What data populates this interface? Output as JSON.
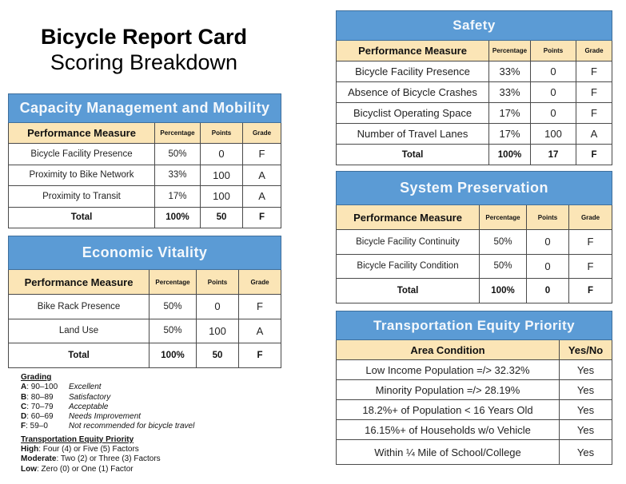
{
  "title": {
    "main": "Bicycle Report Card",
    "sub": "Scoring Breakdown"
  },
  "colors": {
    "banner": "#5b9bd5",
    "header_row": "#fbe5b6"
  },
  "columns": {
    "measure": "Performance Measure",
    "percentage": "Percentage",
    "points": "Points",
    "grade": "Grade"
  },
  "capacity": {
    "title": "Capacity Management and Mobility",
    "rows": [
      {
        "measure": "Bicycle Facility Presence",
        "percentage": "50%",
        "points": "0",
        "grade": "F"
      },
      {
        "measure": "Proximity to Bike Network",
        "percentage": "33%",
        "points": "100",
        "grade": "A"
      },
      {
        "measure": "Proximity to Transit",
        "percentage": "17%",
        "points": "100",
        "grade": "A"
      }
    ],
    "total": {
      "label": "Total",
      "percentage": "100%",
      "points": "50",
      "grade": "F"
    }
  },
  "economic": {
    "title": "Economic Vitality",
    "rows": [
      {
        "measure": "Bike Rack Presence",
        "percentage": "50%",
        "points": "0",
        "grade": "F"
      },
      {
        "measure": "Land Use",
        "percentage": "50%",
        "points": "100",
        "grade": "A"
      }
    ],
    "total": {
      "label": "Total",
      "percentage": "100%",
      "points": "50",
      "grade": "F"
    }
  },
  "safety": {
    "title": "Safety",
    "rows": [
      {
        "measure": "Bicycle Facility Presence",
        "percentage": "33%",
        "points": "0",
        "grade": "F"
      },
      {
        "measure": "Absence of Bicycle Crashes",
        "percentage": "33%",
        "points": "0",
        "grade": "F"
      },
      {
        "measure": "Bicyclist Operating Space",
        "percentage": "17%",
        "points": "0",
        "grade": "F"
      },
      {
        "measure": "Number of Travel Lanes",
        "percentage": "17%",
        "points": "100",
        "grade": "A"
      }
    ],
    "total": {
      "label": "Total",
      "percentage": "100%",
      "points": "17",
      "grade": "F"
    }
  },
  "preservation": {
    "title": "System Preservation",
    "rows": [
      {
        "measure": "Bicycle Facility Continuity",
        "percentage": "50%",
        "points": "0",
        "grade": "F"
      },
      {
        "measure": "Bicycle Facility Condition",
        "percentage": "50%",
        "points": "0",
        "grade": "F"
      }
    ],
    "total": {
      "label": "Total",
      "percentage": "100%",
      "points": "0",
      "grade": "F"
    }
  },
  "equity": {
    "title": "Transportation Equity Priority",
    "col_condition": "Area Condition",
    "col_yesno": "Yes/No",
    "rows": [
      {
        "condition": "Low Income Population =/> 32.32%",
        "value": "Yes"
      },
      {
        "condition": "Minority Population =/> 28.19%",
        "value": "Yes"
      },
      {
        "condition": "18.2%+ of Population < 16 Years Old",
        "value": "Yes"
      },
      {
        "condition": "16.15%+ of Households w/o Vehicle",
        "value": "Yes"
      },
      {
        "condition": "Within ¼ Mile of School/College",
        "value": "Yes"
      }
    ]
  },
  "legend": {
    "grading_heading": "Grading",
    "grades": [
      {
        "letter": "A",
        "range": ": 90–100",
        "desc": "Excellent"
      },
      {
        "letter": "B",
        "range": ": 80–89",
        "desc": "Satisfactory"
      },
      {
        "letter": "C",
        "range": ": 70–79",
        "desc": "Acceptable"
      },
      {
        "letter": "D",
        "range": ": 60–69",
        "desc": "Needs Improvement"
      },
      {
        "letter": "F",
        "range": ": 59–0",
        "desc": "Not recommended for bicycle travel"
      }
    ],
    "equity_heading": "Transportation Equity  Priority",
    "priorities": [
      {
        "level": "High",
        "text": ":  Four (4) or Five (5) Factors"
      },
      {
        "level": "Moderate",
        "text": ": Two (2) or Three (3) Factors"
      },
      {
        "level": "Low",
        "text": ": Zero (0) or One (1) Factor"
      }
    ]
  }
}
